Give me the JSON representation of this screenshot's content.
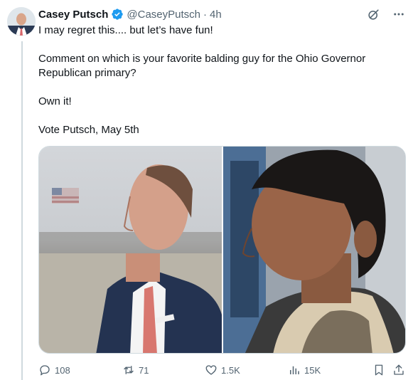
{
  "tweet": {
    "author_name": "Casey Putsch",
    "handle": "@CaseyPutsch",
    "separator": "·",
    "time": "4h",
    "paragraphs": [
      "I may regret this.... but let’s have fun!",
      "Comment on which is your favorite balding guy for the Ohio Governor Republican primary?",
      "Own it!",
      "Vote Putsch, May 5th"
    ]
  },
  "actions": {
    "replies": "108",
    "reposts": "71",
    "likes": "1.5K",
    "views": "15K"
  },
  "colors": {
    "verified": "#1d9bf0",
    "muted": "#536471",
    "text": "#0f1419",
    "border": "#cfd9de"
  },
  "icons": [
    "grok-icon",
    "more-icon",
    "reply-icon",
    "repost-icon",
    "like-icon",
    "views-icon",
    "bookmark-icon",
    "share-icon",
    "verified-badge-icon"
  ]
}
